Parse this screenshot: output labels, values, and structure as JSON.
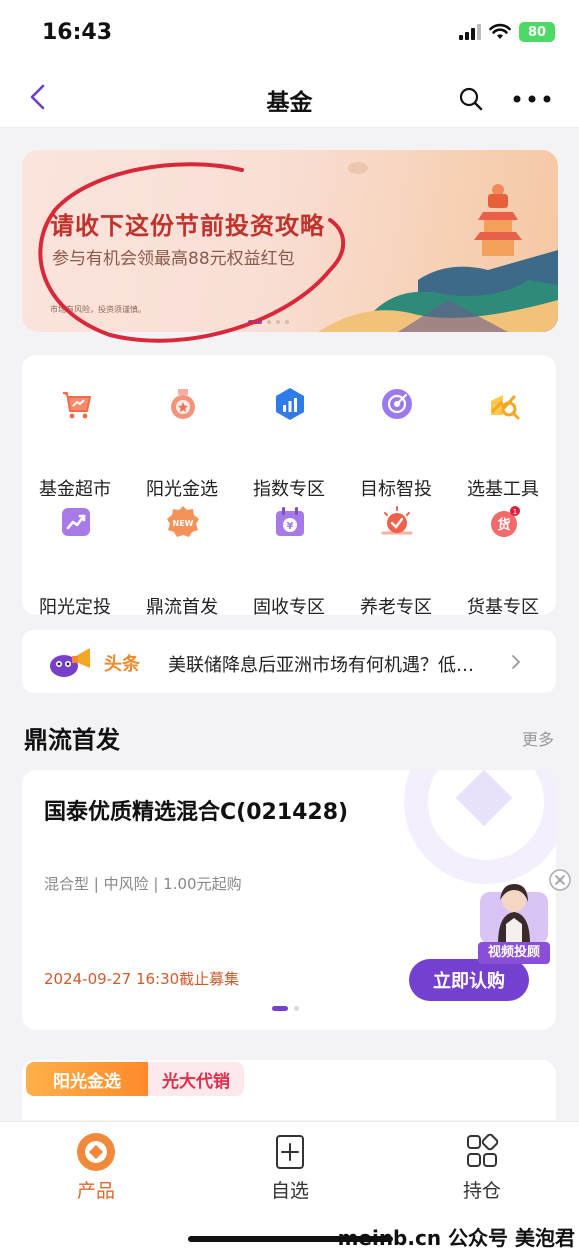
{
  "status_bar": {
    "time": "16:43",
    "battery": "80"
  },
  "nav": {
    "title": "基金"
  },
  "banner": {
    "title": "请收下这份节前投资攻略",
    "subtitle": "参与有机会领最高88元权益红包",
    "note": "市场有风险，投资须谨慎。"
  },
  "menu": {
    "items": [
      {
        "label": "基金超市",
        "icon": "cart-icon",
        "color": "#f26a4a"
      },
      {
        "label": "阳光金选",
        "icon": "medal-icon",
        "color": "#f0705a"
      },
      {
        "label": "指数专区",
        "icon": "chart-bar-icon",
        "color": "#2f7be8"
      },
      {
        "label": "目标智投",
        "icon": "target-icon",
        "color": "#8a6ae8"
      },
      {
        "label": "选基工具",
        "icon": "tool-icon",
        "color": "#f5a623"
      },
      {
        "label": "阳光定投",
        "icon": "trend-icon",
        "color": "#9a6ae0"
      },
      {
        "label": "鼎流首发",
        "icon": "new-badge-icon",
        "color": "#f0804a"
      },
      {
        "label": "固收专区",
        "icon": "calendar-yuan-icon",
        "color": "#9a6ae0"
      },
      {
        "label": "养老专区",
        "icon": "sun-check-icon",
        "color": "#f0604a"
      },
      {
        "label": "货基专区",
        "icon": "money-bag-icon",
        "color": "#f05a5a"
      }
    ]
  },
  "news": {
    "tag": "头条",
    "text": "美联储降息后亚洲市场有何机遇？低…"
  },
  "section": {
    "title": "鼎流首发",
    "more": "更多"
  },
  "fund": {
    "name": "国泰优质精选混合C(021428)",
    "tags": "混合型 | 中风险 | 1.00元起购",
    "deadline": "2024-09-27 16:30截止募集",
    "buy_label": "立即认购"
  },
  "advisor": {
    "label": "视频投顾"
  },
  "tabs": {
    "a": "阳光金选",
    "b": "光大代销"
  },
  "bottom_nav": [
    {
      "label": "产品",
      "active": true
    },
    {
      "label": "自选",
      "active": false
    },
    {
      "label": "持仓",
      "active": false
    }
  ],
  "watermark": "meinb.cn 公众号 美泡君",
  "colors": {
    "accent": "#7440cf",
    "orange": "#e06a2a",
    "banner_red": "#c0322c"
  }
}
